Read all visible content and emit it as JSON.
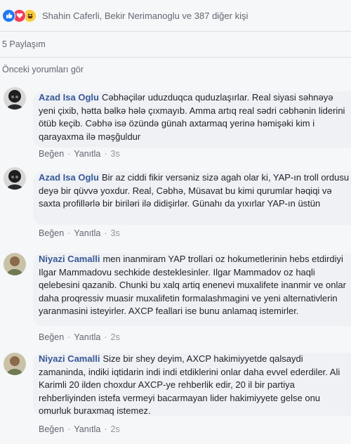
{
  "reactions": {
    "icons": [
      "like-icon",
      "love-icon",
      "haha-icon"
    ],
    "text": "Shahin Caferli, Bekir Nerimanoglu ve 387 diğer kişi"
  },
  "shares": {
    "label": "5 Paylaşım"
  },
  "previous_comments": {
    "label": "Önceki yorumları gör"
  },
  "comments": [
    {
      "author": "Azad Isa Oglu",
      "text": "Cəbhəçilər uduzduqca quduzlaşırlar. Real siyasi səhnəyə yeni çixib, hətta bəlkə hələ çıxmayıb. Amma artıq real sədri cəbhənin liderini ötüb keçib. Cəbhə isə özündə günah axtarmaq yerinə həmişəki kim i qarayaxma ilə məşğuldur",
      "like": "Beğen",
      "reply": "Yanıtla",
      "time": "3s"
    },
    {
      "author": "Azad Isa Oglu",
      "text": "Bir az ciddi fikir versəniz sizə agah olar ki, YAP-ın troll ordusu deyə bir qüvvə yoxdur. Real, Cəbhə, Müsavat bu kimi qurumlar həqiqi və saxta profillərlə bir biriləri ilə didişirlər. Günahı da yıxırlar YAP-ın üstün",
      "like": "Beğen",
      "reply": "Yanıtla",
      "time": "3s"
    },
    {
      "author": "Niyazi Camalli",
      "text": "men inanmiram YAP trollari oz hokumetlerinin hebs etdirdiyi Ilgar Mammadovu sechkide desteklesinler. Ilgar Mammadov oz haqli qelebesini qazanib. Chunki bu xalq artiq enenevi muxalifete inanmir ve onlar daha proqressiv muasir muxalifetin formalashmagini ve yeni alternativlerin yaranmasini isteyirler. AXCP feallari ise bunu anlamaq istemirler.",
      "like": "Beğen",
      "reply": "Yanıtla",
      "time": "2s"
    },
    {
      "author": "Niyazi Camalli",
      "text": "Size bir shey deyim, AXCP hakimiyyetde qalsaydi zamaninda, indiki iqtidarin indi indi etdiklerini onlar daha evvel ederdiler. Ali Karimli 20 ilden choxdur AXCP-ye rehberlik edir, 20 il bir partiya rehberliyinden istefa vermeyi bacarmayan lider hakimiyyete gelse onu omurluk buraxmaq istemez.",
      "like": "Beğen",
      "reply": "Yanıtla",
      "time": "2s"
    }
  ]
}
